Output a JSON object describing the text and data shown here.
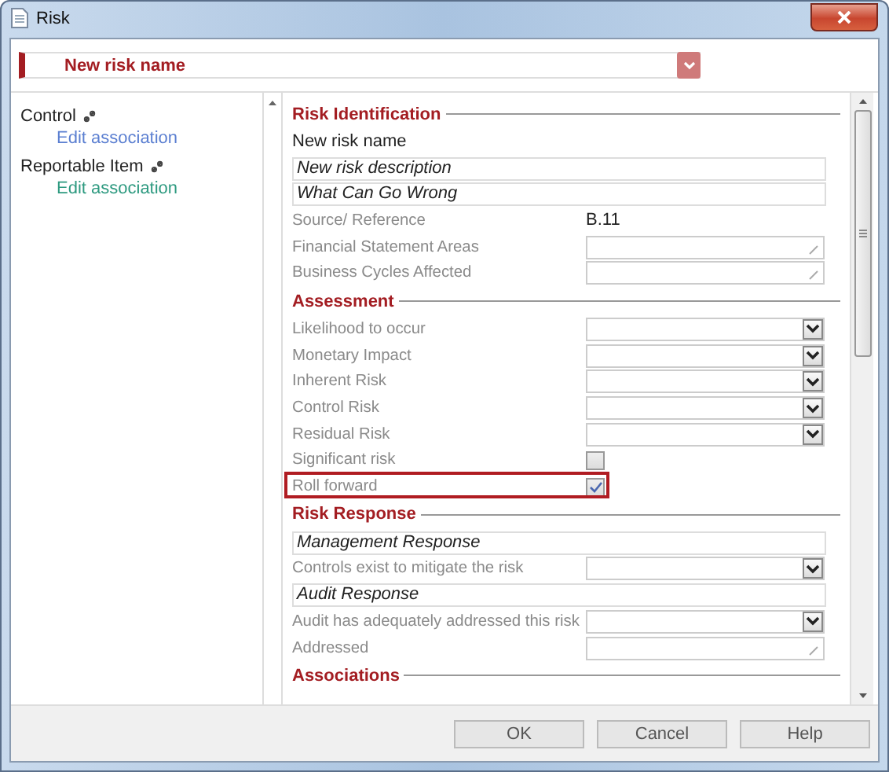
{
  "window": {
    "title": "Risk"
  },
  "header": {
    "value": "New risk name"
  },
  "associations": [
    {
      "label": "Control",
      "link": "Edit association",
      "color": "#5b7fd1"
    },
    {
      "label": "Reportable Item",
      "link": "Edit association",
      "color": "#2e9a80"
    }
  ],
  "sections": [
    {
      "title": "Risk Identification",
      "rows": [
        {
          "kind": "text",
          "text": "New risk name"
        },
        {
          "kind": "input",
          "value": "New risk description"
        },
        {
          "kind": "input",
          "value": "What Can Go Wrong"
        },
        {
          "kind": "value",
          "label": "Source/ Reference",
          "value": "B.11"
        },
        {
          "kind": "edit",
          "label": "Financial Statement Areas"
        },
        {
          "kind": "edit",
          "label": "Business Cycles Affected"
        }
      ]
    },
    {
      "title": "Assessment",
      "rows": [
        {
          "kind": "select",
          "label": "Likelihood to occur"
        },
        {
          "kind": "select",
          "label": "Monetary Impact"
        },
        {
          "kind": "select",
          "label": "Inherent Risk"
        },
        {
          "kind": "select",
          "label": "Control Risk"
        },
        {
          "kind": "select",
          "label": "Residual Risk"
        },
        {
          "kind": "checkbox",
          "label": "Significant risk",
          "checked": false,
          "highlighted": false
        },
        {
          "kind": "checkbox",
          "label": "Roll forward",
          "checked": true,
          "highlighted": true
        }
      ]
    },
    {
      "title": "Risk Response",
      "rows": [
        {
          "kind": "input",
          "value": "Management Response"
        },
        {
          "kind": "select",
          "label": "Controls exist to mitigate the risk"
        },
        {
          "kind": "input",
          "value": "Audit Response"
        },
        {
          "kind": "select",
          "label": "Audit has adequately addressed this risk"
        },
        {
          "kind": "edit",
          "label": "Addressed"
        }
      ]
    },
    {
      "title": "Associations"
    }
  ],
  "buttons": [
    {
      "label": "OK"
    },
    {
      "label": "Cancel"
    },
    {
      "label": "Help"
    }
  ]
}
